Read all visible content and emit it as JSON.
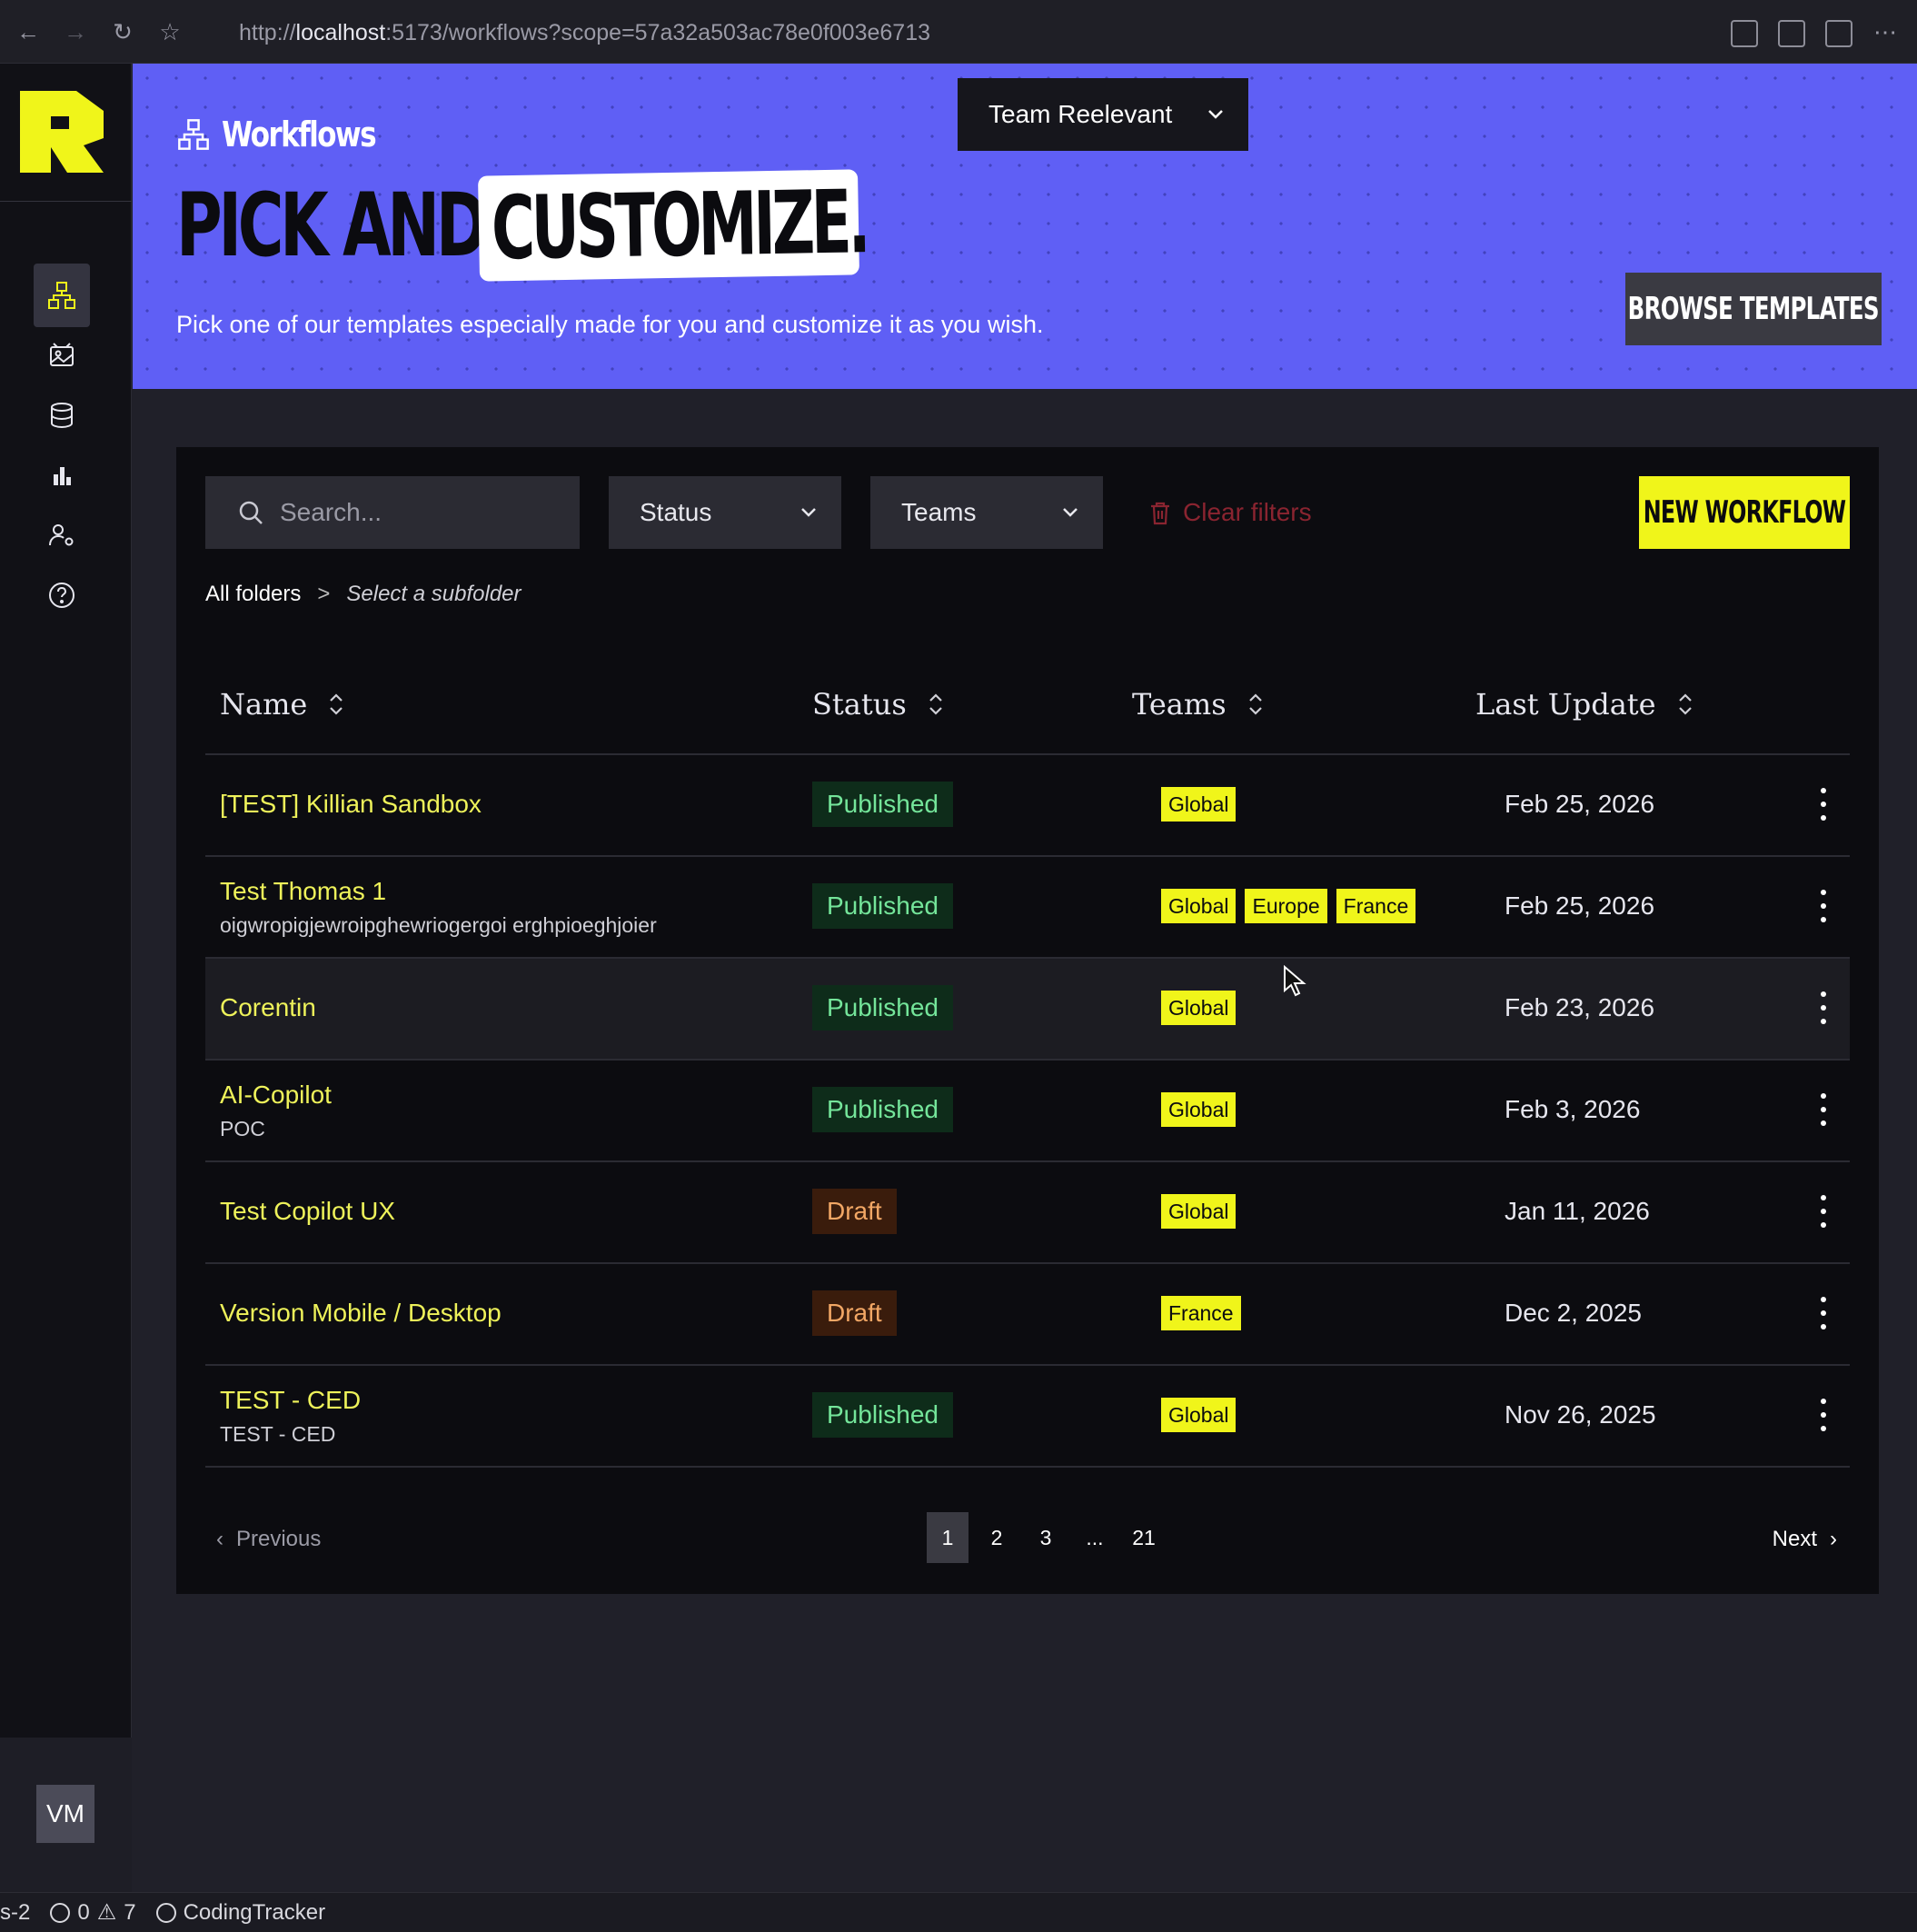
{
  "browser": {
    "url_prefix": "http://",
    "url_host": "localhost",
    "url_rest": ":5173/workflows?scope=57a32a503ac78e0f003e6713"
  },
  "sidebar": {
    "items": [
      {
        "icon": "workflows-icon",
        "active": true
      },
      {
        "icon": "assets-icon",
        "active": false
      },
      {
        "icon": "database-icon",
        "active": false
      },
      {
        "icon": "analytics-icon",
        "active": false
      },
      {
        "icon": "user-settings-icon",
        "active": false
      },
      {
        "icon": "help-icon",
        "active": false
      }
    ],
    "avatar": "VM"
  },
  "hero": {
    "section_title": "Workflows",
    "headline_part1": "PICK AND",
    "headline_part2": "CUSTOMIZE.",
    "description": "Pick one of our templates especially made for you and customize it as you wish.",
    "team_selector": "Team Reelevant",
    "browse_button": "BROWSE TEMPLATES"
  },
  "filters": {
    "search_placeholder": "Search...",
    "status_label": "Status",
    "teams_label": "Teams",
    "clear_label": "Clear filters",
    "new_button": "NEW WORKFLOW"
  },
  "breadcrumb": {
    "root": "All folders",
    "separator": ">",
    "sub": "Select a subfolder"
  },
  "table": {
    "columns": {
      "name": "Name",
      "status": "Status",
      "teams": "Teams",
      "last_update": "Last Update"
    },
    "rows": [
      {
        "name": "[TEST] Killian Sandbox",
        "desc": "",
        "status": "Published",
        "status_kind": "published",
        "teams": [
          "Global"
        ],
        "date": "Feb 25, 2026"
      },
      {
        "name": "Test Thomas 1",
        "desc": "oigwropigjewroipghewriogergoi erghpioeghjoier",
        "status": "Published",
        "status_kind": "published",
        "teams": [
          "Global",
          "Europe",
          "France"
        ],
        "date": "Feb 25, 2026"
      },
      {
        "name": "Corentin",
        "desc": "",
        "status": "Published",
        "status_kind": "published",
        "teams": [
          "Global"
        ],
        "date": "Feb 23, 2026"
      },
      {
        "name": "AI-Copilot",
        "desc": "POC",
        "status": "Published",
        "status_kind": "published",
        "teams": [
          "Global"
        ],
        "date": "Feb 3, 2026"
      },
      {
        "name": "Test Copilot UX",
        "desc": "",
        "status": "Draft",
        "status_kind": "draft",
        "teams": [
          "Global"
        ],
        "date": "Jan 11, 2026"
      },
      {
        "name": "Version Mobile / Desktop",
        "desc": "",
        "status": "Draft",
        "status_kind": "draft",
        "teams": [
          "France"
        ],
        "date": "Dec 2, 2025"
      },
      {
        "name": "TEST - CED",
        "desc": "TEST - CED",
        "status": "Published",
        "status_kind": "published",
        "teams": [
          "Global"
        ],
        "date": "Nov 26, 2025"
      }
    ]
  },
  "pagination": {
    "previous": "Previous",
    "next": "Next",
    "pages": [
      "1",
      "2",
      "3",
      "...",
      "21"
    ],
    "current": "1"
  },
  "statusbar": {
    "branch": "s-2",
    "errors": "0",
    "warnings": "7",
    "extension": "CodingTracker"
  },
  "colors": {
    "accent_yellow": "#f0f51a",
    "hero_purple": "#5f5ff5",
    "published_text": "#74e59a",
    "draft_text": "#f2a765"
  }
}
